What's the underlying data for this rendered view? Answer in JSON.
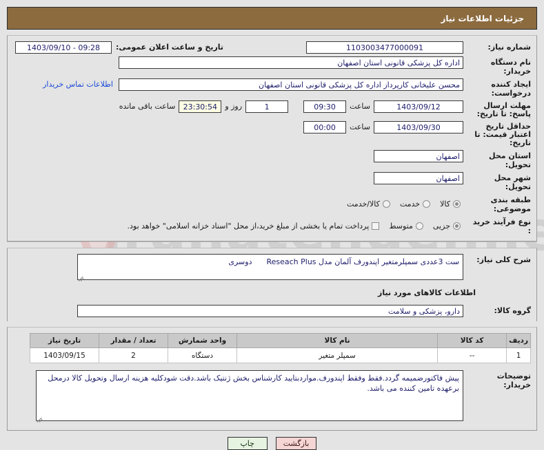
{
  "header": {
    "title": "جزئیات اطلاعات نیاز"
  },
  "fields": {
    "need_number_label": "شماره نیاز:",
    "need_number_value": "1103003477000091",
    "announce_label": "تاریخ و ساعت اعلان عمومی:",
    "announce_value": "09:28 - 1403/09/10",
    "buyer_org_label": "نام دستگاه خریدار:",
    "buyer_org_value": "اداره کل پزشکی قانونی استان اصفهان",
    "creator_label": "ایجاد کننده درخواست:",
    "creator_value": "محسن علیخانی کارپرداز اداره کل پزشکی قانونی استان اصفهان",
    "contact_link": "اطلاعات تماس خریدار",
    "reply_deadline_label": "مهلت ارسال پاسخ: تا تاریخ:",
    "reply_deadline_date": "1403/09/12",
    "hour_label": "ساعت",
    "reply_deadline_time": "09:30",
    "days_remaining": "1",
    "days_and_text": "روز و",
    "countdown": "23:30:54",
    "remaining_hours_text": "ساعت باقی مانده",
    "price_validity_label": "حداقل تاریخ اعتبار قیمت: تا تاریخ:",
    "price_validity_date": "1403/09/30",
    "price_validity_time": "00:00",
    "province_label": "استان محل تحویل:",
    "province_value": "اصفهان",
    "city_label": "شهر محل تحویل:",
    "city_value": "اصفهان",
    "subject_class_label": "طبقه بندی موضوعی:",
    "subject_options": [
      {
        "label": "کالا",
        "selected": true
      },
      {
        "label": "خدمت",
        "selected": false
      },
      {
        "label": "کالا/خدمت",
        "selected": false
      }
    ],
    "process_type_label": "نوع فرآیند خرید :",
    "process_options": [
      {
        "label": "جزیی",
        "selected": true
      },
      {
        "label": "متوسط",
        "selected": false
      }
    ],
    "treasury_checkbox_label": "پرداخت تمام یا بخشی از مبلغ خرید،از محل \"اسناد خزانه اسلامی\" خواهد بود.",
    "treasury_checked": false,
    "general_desc_label": "شرح کلی نیاز:",
    "general_desc_value": "ست 3عددی سمپلرمتغیر اپندورف آلمان مدل Reseach Plus      دوسری",
    "goods_section_title": "اطلاعات کالاهای مورد نیاز",
    "goods_group_label": "گروه کالا:",
    "goods_group_value": "دارو، پزشکی و سلامت",
    "buyer_notes_label": "توضیحات خریدار:",
    "buyer_notes_value": "پیش فاکتورضمیمه گردد.فقط وفقط اپندورف.مواردبتایید کارشناس بخش ژنتیک باشد.دقت شودکلیه هزینه ارسال وتحویل کالا درمحل برعهده تامین کننده می باشد."
  },
  "items_table": {
    "columns": [
      "ردیف",
      "کد کالا",
      "نام کالا",
      "واحد شمارش",
      "تعداد / مقدار",
      "تاریخ نیاز"
    ],
    "rows": [
      [
        "1",
        "--",
        "سمپلر متغیر",
        "دستگاه",
        "2",
        "1403/09/15"
      ]
    ]
  },
  "footer": {
    "back_label": "بازگشت",
    "print_label": "چاپ"
  },
  "watermark": {
    "text": "iranatender.net"
  },
  "colors": {
    "header_brown": "#8c6b3f",
    "link_blue": "#1b49d8",
    "back_btn": "#f6d5d5",
    "print_btn": "#e6f3e1",
    "countdown_bg": "#fdfde4"
  }
}
